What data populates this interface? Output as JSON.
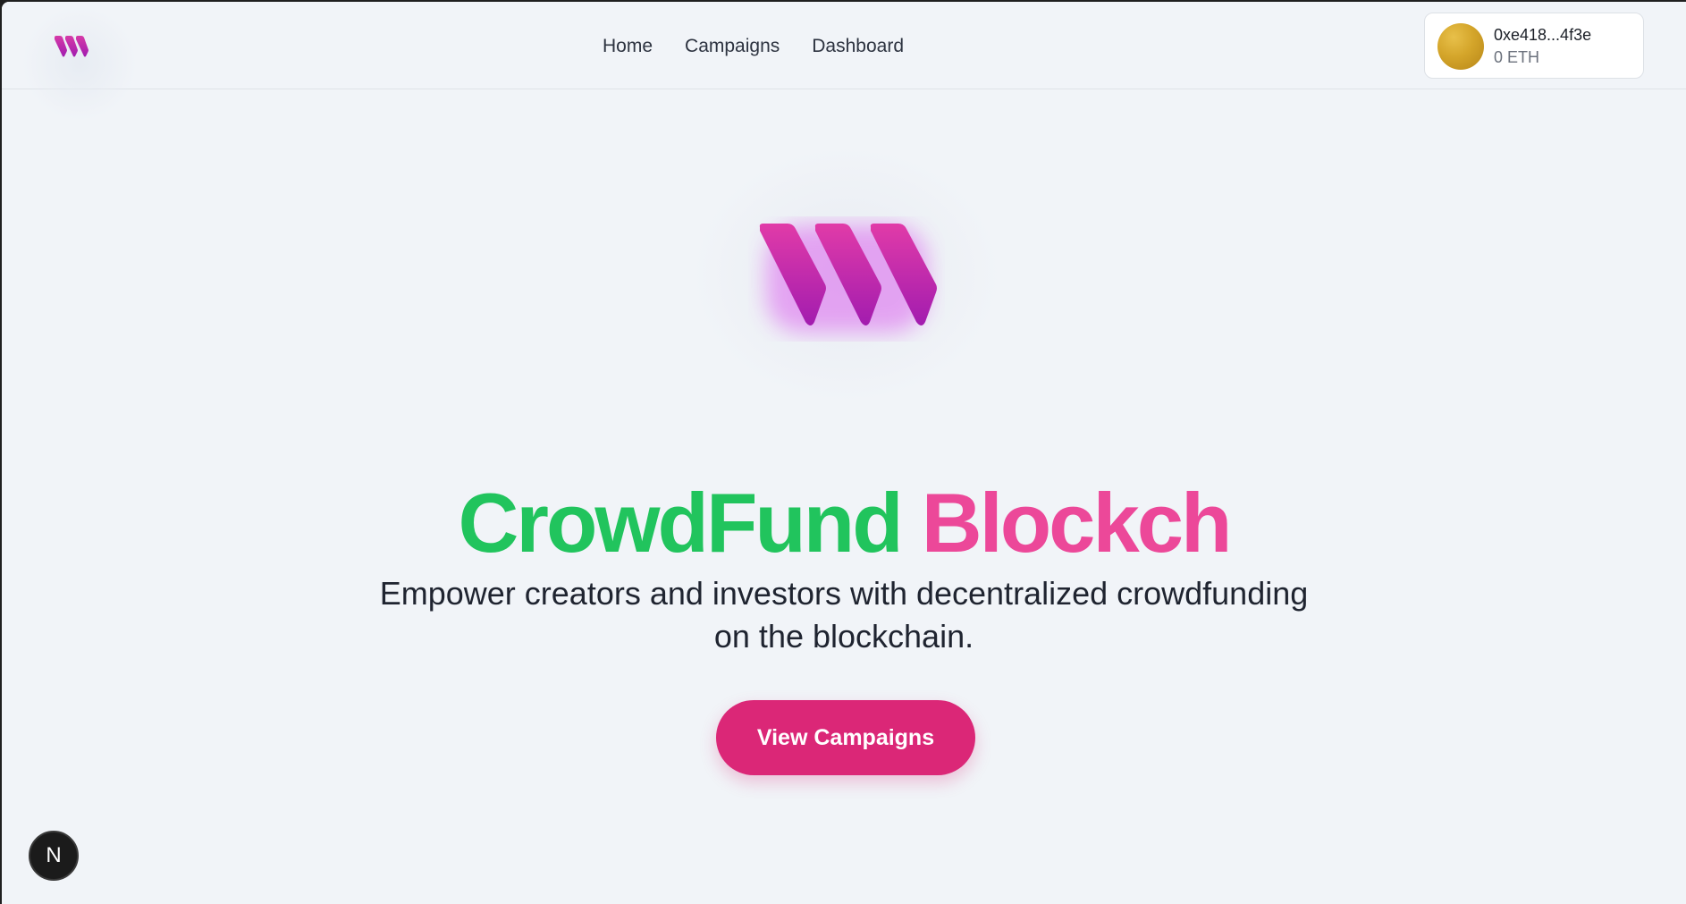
{
  "brand": {
    "logo_icon": "triple-slash-logo-icon",
    "accent_color": "#c026d3"
  },
  "nav": {
    "links": [
      {
        "label": "Home"
      },
      {
        "label": "Campaigns"
      },
      {
        "label": "Dashboard"
      }
    ]
  },
  "wallet": {
    "address": "0xe418...4f3e",
    "balance": "0 ETH",
    "avatar_icon": "gold-gradient-avatar"
  },
  "hero": {
    "title_part1": "CrowdFund",
    "title_part2": "Blockch",
    "title_part1_color": "#21c45d",
    "title_part2_color": "#ec4899",
    "subtitle_line1": "Empower creators and investors with decentralized crowdfunding",
    "subtitle_line2": "on the blockchain.",
    "cta_label": "View Campaigns",
    "cta_color": "#db2777"
  },
  "dev_indicator": {
    "label": "N"
  }
}
